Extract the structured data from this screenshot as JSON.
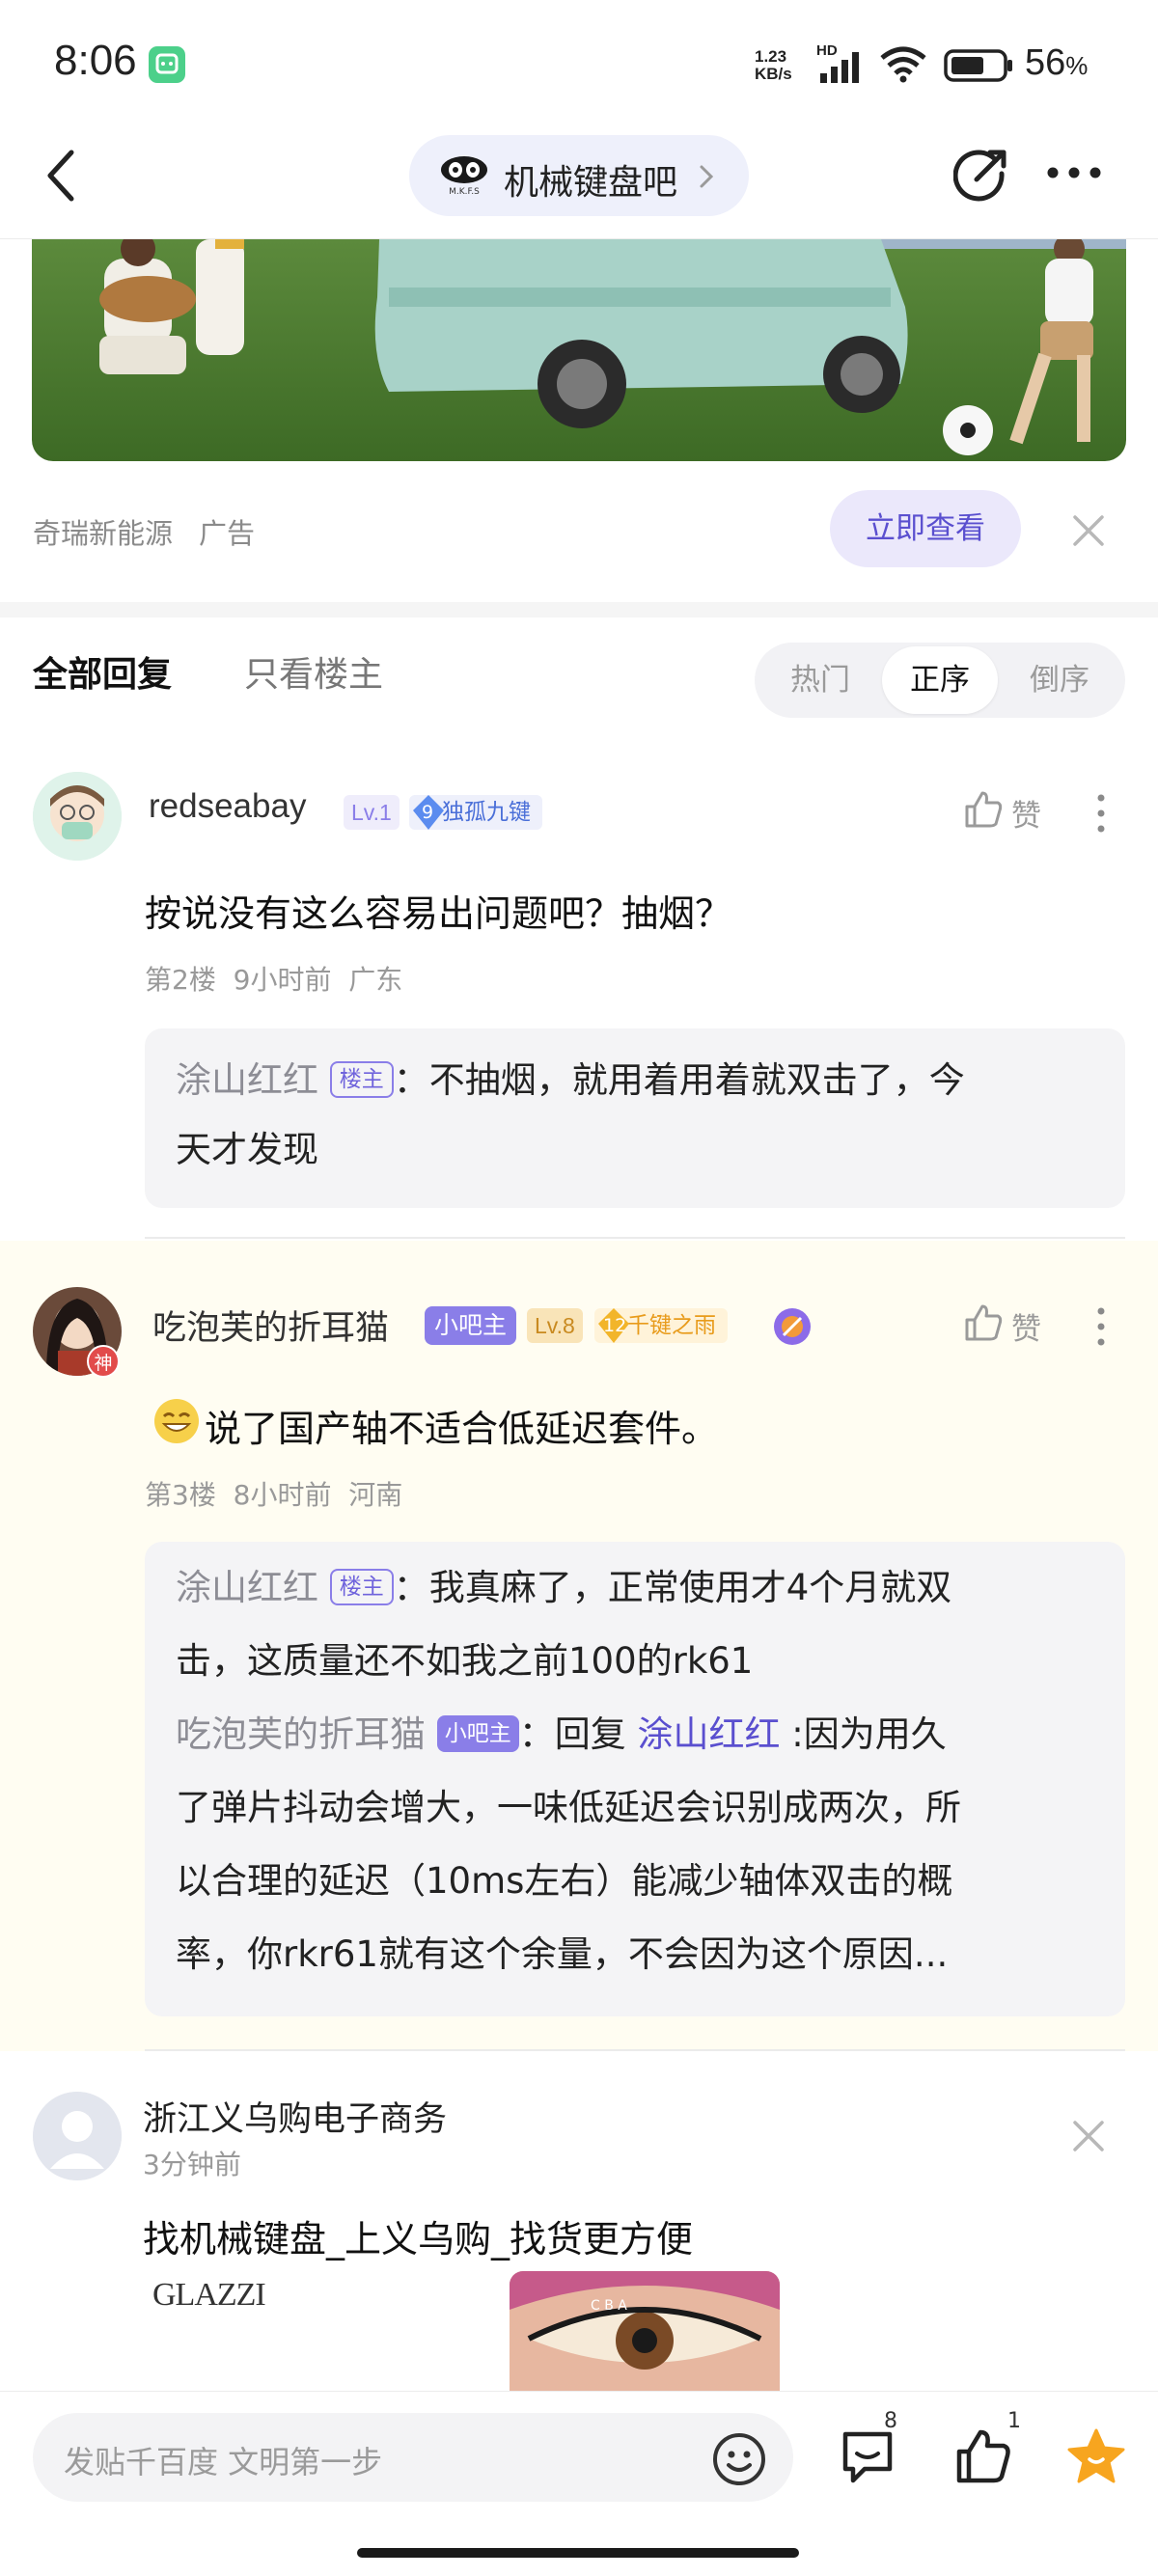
{
  "status_bar": {
    "time": "8:06",
    "net_speed_value": "1.23",
    "net_speed_unit": "KB/s",
    "network_label": "HD",
    "battery": "56",
    "battery_unit": "%"
  },
  "nav": {
    "forum_name": "机械键盘吧",
    "forum_logo_text": "M.K.F.S"
  },
  "ad": {
    "source": "奇瑞新能源",
    "tag": "广告",
    "button": "立即查看",
    "colors": {
      "button_bg": "#ebe8fb",
      "button_text": "#5a4fcf"
    }
  },
  "tabs": {
    "all": "全部回复",
    "owner_only": "只看楼主",
    "sort": [
      "热门",
      "正序",
      "倒序"
    ],
    "sort_selected": "正序"
  },
  "posts": [
    {
      "username": "redseabay",
      "level": "Lv.1",
      "honor_num": "9",
      "honor": "独孤九键",
      "like_label": "赞",
      "content": "按说没有这么容易出问题吧？抽烟？",
      "floor": "第2楼",
      "time": "9小时前",
      "region": "广东",
      "replies": [
        {
          "name": "涂山红红",
          "tag": "楼主",
          "line1": "：不抽烟，就用着用着就双击了，今",
          "line2": "天才发现"
        }
      ]
    },
    {
      "username": "吃泡芙的折耳猫",
      "moderator": "小吧主",
      "level": "Lv.8",
      "honor_num": "12",
      "honor": "千键之雨",
      "avatar_badge": "神",
      "like_label": "赞",
      "content": "说了国产轴不适合低延迟套件。",
      "floor": "第3楼",
      "time": "8小时前",
      "region": "河南",
      "replies": [
        {
          "name": "涂山红红",
          "tag": "楼主",
          "line1": "：我真麻了，正常使用才4个月就双",
          "line2": "击，这质量还不如我之前100的rk61"
        },
        {
          "name": "吃泡芙的折耳猫",
          "tag": "小吧主",
          "prefix": "：回复 ",
          "mention": "涂山红红",
          "line1_rest": " :因为用久",
          "line2": "了弹片抖动会增大，一味低延迟会识别成两次，所",
          "line3": "以合理的延迟（10ms左右）能减少轴体双击的概",
          "line4": "率，你rkr61就有这个余量，不会因为这个原因..."
        }
      ]
    }
  ],
  "ad_post": {
    "username": "浙江义乌购电子商务",
    "time": "3分钟前",
    "content": "找机械键盘_上义乌购_找货更方便",
    "brand": "GLAZZI",
    "image_letters": "C B A"
  },
  "bottom_bar": {
    "placeholder": "发贴千百度 文明第一步",
    "comment_count": "8",
    "like_count": "1"
  }
}
